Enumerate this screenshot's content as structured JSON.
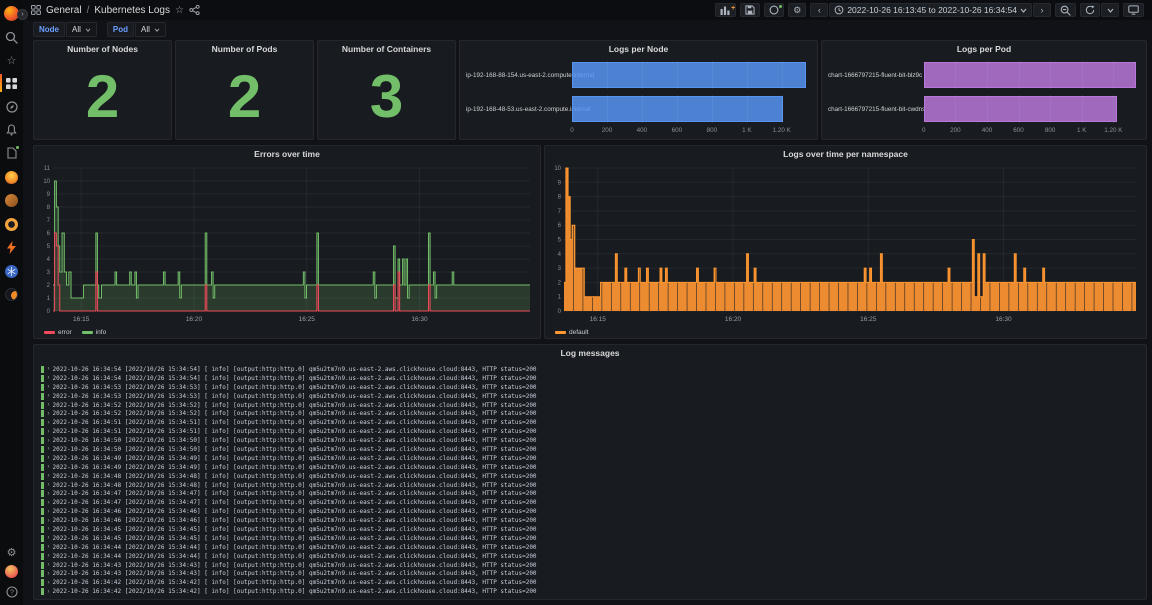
{
  "topnav": {
    "breadcrumb": {
      "section": "General",
      "separator": "/",
      "page": "Kubernetes Logs"
    },
    "time_range": "2022-10-26 16:13:45 to 2022-10-26 16:34:54",
    "toolbar_icons": [
      "add-panel",
      "save-dashboard",
      "dashboard-insights",
      "dashboard-settings",
      "time-back",
      "clock",
      "time-forward",
      "zoom-out",
      "refresh",
      "refresh-interval-caret",
      "kiosk-mode"
    ],
    "breadcrumb_icons": [
      "dashboards-grid",
      "favorite-star",
      "share"
    ]
  },
  "sidebar": {
    "icons": [
      "grafana-logo",
      "search",
      "starred",
      "dashboards",
      "explore",
      "alerting",
      "docs-page",
      "app-plugin-1",
      "app-plugin-2",
      "app-plugin-3",
      "app-plugin-4",
      "app-plugin-5",
      "app-plugin-6",
      "settings-gear",
      "user-avatar",
      "help"
    ]
  },
  "variables": [
    {
      "label": "Node",
      "value": "All"
    },
    {
      "label": "Pod",
      "value": "All"
    }
  ],
  "chart_data": [
    {
      "type": "stat",
      "title": "Number of Nodes",
      "value": "2",
      "color": "#73BF69"
    },
    {
      "type": "stat",
      "title": "Number of Pods",
      "value": "2",
      "color": "#73BF69"
    },
    {
      "type": "stat",
      "title": "Number of Containers",
      "value": "3",
      "color": "#73BF69"
    },
    {
      "type": "bar",
      "orientation": "horizontal",
      "title": "Logs per Node",
      "categories": [
        "ip-192-168-88-154.us-east-2.compute.internal",
        "ip-192-168-48-53.us-east-2.compute.internal"
      ],
      "values": [
        1337,
        1206
      ],
      "xmax": 1350,
      "color": "#5794F2",
      "xticks": [
        {
          "value": 0,
          "label": "0"
        },
        {
          "value": 200,
          "label": "200"
        },
        {
          "value": 400,
          "label": "400"
        },
        {
          "value": 600,
          "label": "600"
        },
        {
          "value": 800,
          "label": "800"
        },
        {
          "value": 1000,
          "label": "1 K"
        },
        {
          "value": 1200,
          "label": "1.20 K"
        }
      ]
    },
    {
      "type": "bar",
      "orientation": "horizontal",
      "title": "Logs per Pod",
      "categories": [
        "chart-1666797215-fluent-bit-blz9c",
        "chart-1666797215-fluent-bit-cwdns"
      ],
      "values": [
        1345,
        1225
      ],
      "xmax": 1350,
      "color": "#B877D9",
      "xticks": [
        {
          "value": 0,
          "label": "0"
        },
        {
          "value": 200,
          "label": "200"
        },
        {
          "value": 400,
          "label": "400"
        },
        {
          "value": 600,
          "label": "600"
        },
        {
          "value": 800,
          "label": "800"
        },
        {
          "value": 1000,
          "label": "1 K"
        },
        {
          "value": 1200,
          "label": "1.20 K"
        }
      ]
    },
    {
      "type": "line",
      "title": "Errors over time",
      "x_domain_minutes": [
        13.75,
        34.9
      ],
      "ylim": [
        0,
        11
      ],
      "ytick_step": 1,
      "legend_position": "bottom",
      "xticks": [
        {
          "value": 15,
          "label": "16:15"
        },
        {
          "value": 20,
          "label": "16:20"
        },
        {
          "value": 25,
          "label": "16:25"
        },
        {
          "value": 30,
          "label": "16:30"
        }
      ],
      "series": [
        {
          "name": "error",
          "color": "#F2495C",
          "fill_opacity": 0.08,
          "points": [
            [
              13.75,
              0
            ],
            [
              13.82,
              6
            ],
            [
              13.9,
              5
            ],
            [
              13.98,
              2
            ],
            [
              14.05,
              0
            ],
            [
              15.65,
              3
            ],
            [
              15.72,
              0
            ],
            [
              20.5,
              2
            ],
            [
              20.57,
              0
            ],
            [
              25.45,
              2
            ],
            [
              25.52,
              0
            ],
            [
              28.85,
              2
            ],
            [
              28.92,
              0
            ],
            [
              29.05,
              3
            ],
            [
              29.12,
              0
            ],
            [
              30.4,
              2
            ],
            [
              30.47,
              0
            ],
            [
              34.9,
              0
            ]
          ]
        },
        {
          "name": "info",
          "color": "#73BF69",
          "fill_opacity": 0.2,
          "points": [
            [
              13.75,
              2
            ],
            [
              13.82,
              10
            ],
            [
              13.9,
              8
            ],
            [
              13.98,
              5
            ],
            [
              14.05,
              3
            ],
            [
              14.15,
              6
            ],
            [
              14.25,
              3
            ],
            [
              14.35,
              2
            ],
            [
              14.45,
              3
            ],
            [
              14.55,
              1
            ],
            [
              15.1,
              2
            ],
            [
              15.65,
              6
            ],
            [
              15.72,
              2
            ],
            [
              15.78,
              1
            ],
            [
              15.9,
              2
            ],
            [
              16.5,
              3
            ],
            [
              16.57,
              2
            ],
            [
              17.15,
              3
            ],
            [
              17.22,
              2
            ],
            [
              17.38,
              3
            ],
            [
              17.45,
              1
            ],
            [
              17.52,
              2
            ],
            [
              18.65,
              3
            ],
            [
              18.72,
              2
            ],
            [
              19.3,
              3
            ],
            [
              19.37,
              1
            ],
            [
              19.44,
              2
            ],
            [
              20.5,
              6
            ],
            [
              20.57,
              2
            ],
            [
              20.78,
              3
            ],
            [
              20.85,
              1
            ],
            [
              20.92,
              2
            ],
            [
              24.85,
              3
            ],
            [
              24.92,
              1
            ],
            [
              24.99,
              2
            ],
            [
              25.45,
              6
            ],
            [
              25.52,
              2
            ],
            [
              27.95,
              3
            ],
            [
              28.02,
              1
            ],
            [
              28.09,
              2
            ],
            [
              28.85,
              5
            ],
            [
              28.92,
              1
            ],
            [
              29.05,
              4
            ],
            [
              29.12,
              2
            ],
            [
              29.25,
              4
            ],
            [
              29.32,
              2
            ],
            [
              29.4,
              4
            ],
            [
              29.47,
              1
            ],
            [
              29.54,
              2
            ],
            [
              30.4,
              6
            ],
            [
              30.47,
              2
            ],
            [
              30.62,
              3
            ],
            [
              30.69,
              1
            ],
            [
              30.76,
              2
            ],
            [
              31.45,
              3
            ],
            [
              31.52,
              2
            ],
            [
              34.9,
              2
            ]
          ]
        }
      ]
    },
    {
      "type": "bar-time",
      "title": "Logs over time per namespace",
      "x_domain_minutes": [
        13.75,
        34.9
      ],
      "ylim": [
        0,
        10
      ],
      "ytick_step": 1,
      "legend_position": "bottom",
      "xticks": [
        {
          "value": 15,
          "label": "16:15"
        },
        {
          "value": 20,
          "label": "16:20"
        },
        {
          "value": 25,
          "label": "16:25"
        },
        {
          "value": 30,
          "label": "16:30"
        }
      ],
      "series": [
        {
          "name": "default",
          "color": "#FF9830",
          "fill": "#ED8B31",
          "fill_opacity": 1,
          "points": [
            [
              13.75,
              2
            ],
            [
              13.82,
              10
            ],
            [
              13.9,
              8
            ],
            [
              13.98,
              5
            ],
            [
              14.05,
              6
            ],
            [
              14.15,
              3
            ],
            [
              14.35,
              3
            ],
            [
              14.5,
              1
            ],
            [
              15.1,
              2
            ],
            [
              15.65,
              4
            ],
            [
              15.72,
              2
            ],
            [
              16.0,
              3
            ],
            [
              16.07,
              2
            ],
            [
              16.5,
              3
            ],
            [
              16.57,
              2
            ],
            [
              16.8,
              3
            ],
            [
              16.87,
              2
            ],
            [
              17.3,
              3
            ],
            [
              17.37,
              2
            ],
            [
              17.5,
              3
            ],
            [
              17.57,
              2
            ],
            [
              18.65,
              3
            ],
            [
              18.72,
              2
            ],
            [
              19.3,
              3
            ],
            [
              19.37,
              2
            ],
            [
              20.5,
              4
            ],
            [
              20.57,
              2
            ],
            [
              20.78,
              3
            ],
            [
              20.85,
              2
            ],
            [
              24.85,
              3
            ],
            [
              24.92,
              2
            ],
            [
              25.05,
              3
            ],
            [
              25.12,
              2
            ],
            [
              25.45,
              4
            ],
            [
              25.52,
              2
            ],
            [
              27.95,
              3
            ],
            [
              28.02,
              2
            ],
            [
              28.85,
              5
            ],
            [
              28.92,
              1
            ],
            [
              29.05,
              4
            ],
            [
              29.12,
              1
            ],
            [
              29.25,
              4
            ],
            [
              29.32,
              2
            ],
            [
              30.4,
              4
            ],
            [
              30.47,
              2
            ],
            [
              30.75,
              3
            ],
            [
              30.82,
              2
            ],
            [
              31.45,
              3
            ],
            [
              31.52,
              2
            ],
            [
              34.9,
              2
            ]
          ]
        }
      ]
    }
  ],
  "logs": {
    "title": "Log messages",
    "level": "info",
    "lines": [
      "2022-10-26 16:34:54 [2022/10/26 15:34:54] [ info] [output:http:http.0] qm5u2tm7n9.us-east-2.aws.clickhouse.cloud:8443, HTTP status=200",
      "2022-10-26 16:34:54 [2022/10/26 15:34:54] [ info] [output:http:http.0] qm5u2tm7n9.us-east-2.aws.clickhouse.cloud:8443, HTTP status=200",
      "2022-10-26 16:34:53 [2022/10/26 15:34:53] [ info] [output:http:http.0] qm5u2tm7n9.us-east-2.aws.clickhouse.cloud:8443, HTTP status=200",
      "2022-10-26 16:34:53 [2022/10/26 15:34:53] [ info] [output:http:http.0] qm5u2tm7n9.us-east-2.aws.clickhouse.cloud:8443, HTTP status=200",
      "2022-10-26 16:34:52 [2022/10/26 15:34:52] [ info] [output:http:http.0] qm5u2tm7n9.us-east-2.aws.clickhouse.cloud:8443, HTTP status=200",
      "2022-10-26 16:34:52 [2022/10/26 15:34:52] [ info] [output:http:http.0] qm5u2tm7n9.us-east-2.aws.clickhouse.cloud:8443, HTTP status=200",
      "2022-10-26 16:34:51 [2022/10/26 15:34:51] [ info] [output:http:http.0] qm5u2tm7n9.us-east-2.aws.clickhouse.cloud:8443, HTTP status=200",
      "2022-10-26 16:34:51 [2022/10/26 15:34:51] [ info] [output:http:http.0] qm5u2tm7n9.us-east-2.aws.clickhouse.cloud:8443, HTTP status=200",
      "2022-10-26 16:34:50 [2022/10/26 15:34:50] [ info] [output:http:http.0] qm5u2tm7n9.us-east-2.aws.clickhouse.cloud:8443, HTTP status=200",
      "2022-10-26 16:34:50 [2022/10/26 15:34:50] [ info] [output:http:http.0] qm5u2tm7n9.us-east-2.aws.clickhouse.cloud:8443, HTTP status=200",
      "2022-10-26 16:34:49 [2022/10/26 15:34:49] [ info] [output:http:http.0] qm5u2tm7n9.us-east-2.aws.clickhouse.cloud:8443, HTTP status=200",
      "2022-10-26 16:34:49 [2022/10/26 15:34:49] [ info] [output:http:http.0] qm5u2tm7n9.us-east-2.aws.clickhouse.cloud:8443, HTTP status=200",
      "2022-10-26 16:34:48 [2022/10/26 15:34:48] [ info] [output:http:http.0] qm5u2tm7n9.us-east-2.aws.clickhouse.cloud:8443, HTTP status=200",
      "2022-10-26 16:34:48 [2022/10/26 15:34:48] [ info] [output:http:http.0] qm5u2tm7n9.us-east-2.aws.clickhouse.cloud:8443, HTTP status=200",
      "2022-10-26 16:34:47 [2022/10/26 15:34:47] [ info] [output:http:http.0] qm5u2tm7n9.us-east-2.aws.clickhouse.cloud:8443, HTTP status=200",
      "2022-10-26 16:34:47 [2022/10/26 15:34:47] [ info] [output:http:http.0] qm5u2tm7n9.us-east-2.aws.clickhouse.cloud:8443, HTTP status=200",
      "2022-10-26 16:34:46 [2022/10/26 15:34:46] [ info] [output:http:http.0] qm5u2tm7n9.us-east-2.aws.clickhouse.cloud:8443, HTTP status=200",
      "2022-10-26 16:34:46 [2022/10/26 15:34:46] [ info] [output:http:http.0] qm5u2tm7n9.us-east-2.aws.clickhouse.cloud:8443, HTTP status=200",
      "2022-10-26 16:34:45 [2022/10/26 15:34:45] [ info] [output:http:http.0] qm5u2tm7n9.us-east-2.aws.clickhouse.cloud:8443, HTTP status=200",
      "2022-10-26 16:34:45 [2022/10/26 15:34:45] [ info] [output:http:http.0] qm5u2tm7n9.us-east-2.aws.clickhouse.cloud:8443, HTTP status=200",
      "2022-10-26 16:34:44 [2022/10/26 15:34:44] [ info] [output:http:http.0] qm5u2tm7n9.us-east-2.aws.clickhouse.cloud:8443, HTTP status=200",
      "2022-10-26 16:34:44 [2022/10/26 15:34:44] [ info] [output:http:http.0] qm5u2tm7n9.us-east-2.aws.clickhouse.cloud:8443, HTTP status=200",
      "2022-10-26 16:34:43 [2022/10/26 15:34:43] [ info] [output:http:http.0] qm5u2tm7n9.us-east-2.aws.clickhouse.cloud:8443, HTTP status=200",
      "2022-10-26 16:34:43 [2022/10/26 15:34:43] [ info] [output:http:http.0] qm5u2tm7n9.us-east-2.aws.clickhouse.cloud:8443, HTTP status=200",
      "2022-10-26 16:34:42 [2022/10/26 15:34:42] [ info] [output:http:http.0] qm5u2tm7n9.us-east-2.aws.clickhouse.cloud:8443, HTTP status=200",
      "2022-10-26 16:34:42 [2022/10/26 15:34:42] [ info] [output:http:http.0] qm5u2tm7n9.us-east-2.aws.clickhouse.cloud:8443, HTTP status=200"
    ]
  }
}
